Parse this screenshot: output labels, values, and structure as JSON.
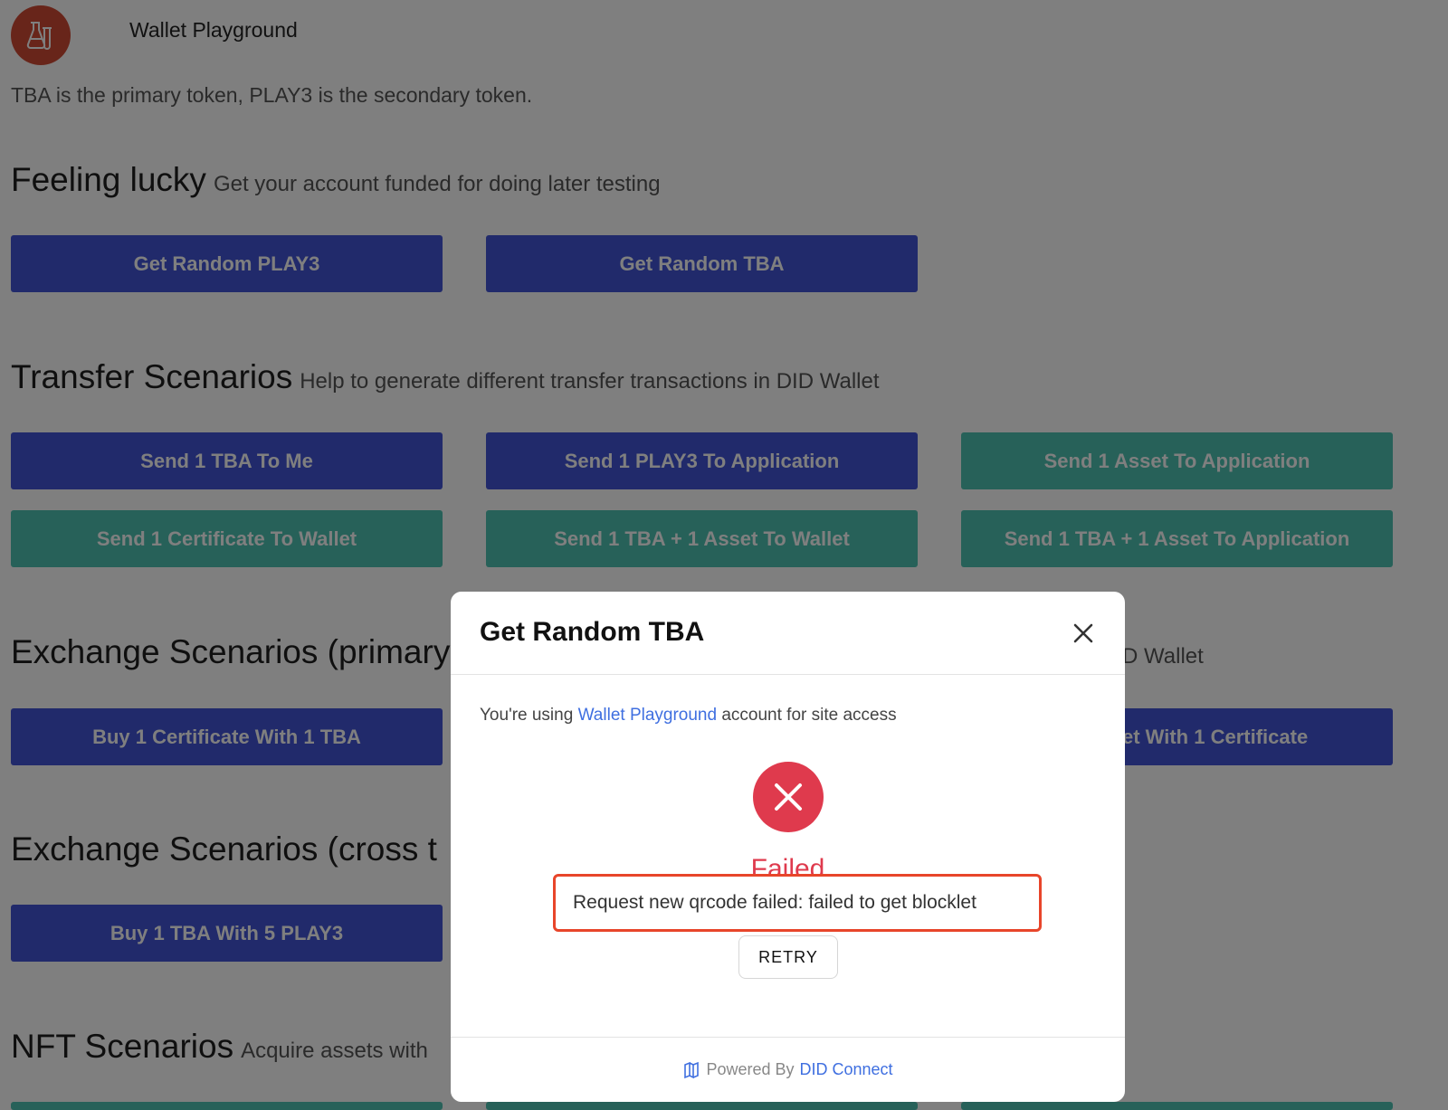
{
  "header": {
    "logo_icon": "flask-lab-icon",
    "app_title": "Wallet Playground"
  },
  "intro": "TBA is the primary token, PLAY3 is the secondary token.",
  "sections": {
    "feeling_lucky": {
      "title": "Feeling lucky",
      "subtitle": "Get your account funded for doing later testing",
      "buttons": [
        "Get Random PLAY3",
        "Get Random TBA"
      ]
    },
    "transfer": {
      "title": "Transfer Scenarios",
      "subtitle": "Help to generate different transfer transactions in DID Wallet",
      "buttons": [
        "Send 1 TBA To Me",
        "Send 1 PLAY3 To Application",
        "Send 1 Asset To Application",
        "Send 1 Certificate To Wallet",
        "Send 1 TBA + 1 Asset To Wallet",
        "Send 1 TBA + 1 Asset To Application"
      ]
    },
    "exchange_primary": {
      "title": "Exchange Scenarios (primary",
      "subtitle_tail": "D Wallet",
      "buttons": [
        "Buy 1 Certificate With 1 TBA",
        "et With 1 Certificate"
      ]
    },
    "exchange_cross": {
      "title": "Exchange Scenarios (cross t",
      "buttons": [
        "Buy 1 TBA With 5 PLAY3"
      ]
    },
    "nft": {
      "title": "NFT Scenarios",
      "subtitle": "Acquire assets with"
    }
  },
  "modal": {
    "title": "Get Random TBA",
    "close_icon": "close-icon",
    "access_prefix": "You're using",
    "access_link": "Wallet Playground",
    "access_suffix": "account for site access",
    "status_icon": "error-x-icon",
    "status_label": "Failed",
    "error_message": "Request new qrcode failed: failed to get blocklet",
    "retry_label": "RETRY",
    "footer_prefix": "Powered By",
    "footer_brand": "DID Connect"
  },
  "colors": {
    "primary_button": "#4355d6",
    "teal_button": "#4ec2b2",
    "error": "#df3a4d",
    "highlight_border": "#e8452a",
    "link": "#3f6fe0"
  }
}
